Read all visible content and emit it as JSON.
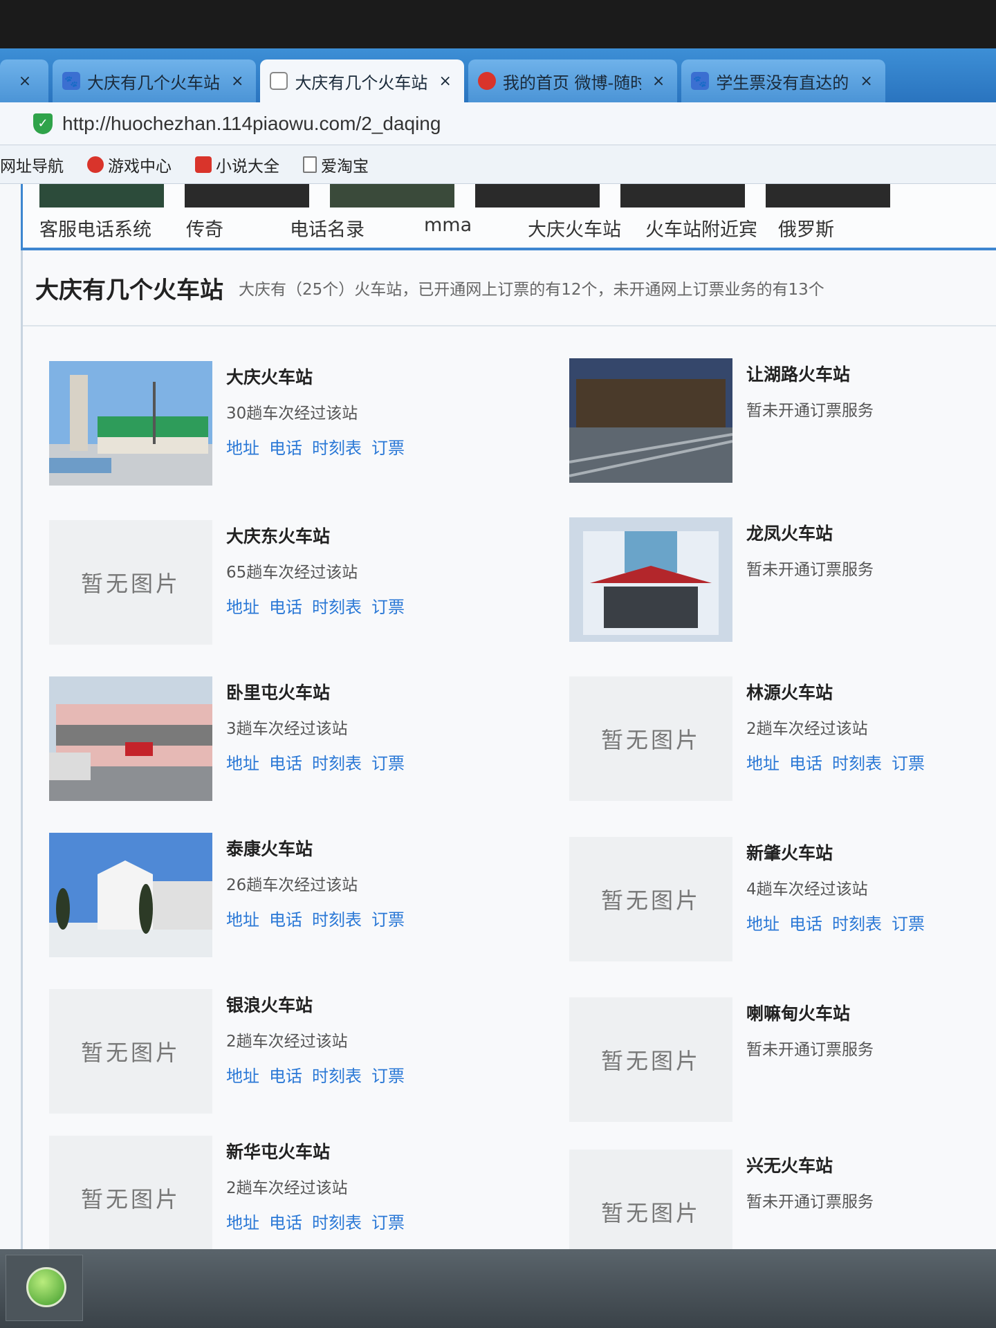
{
  "browser": {
    "tabs": [
      {
        "title": "大庆有几个火车站",
        "active": false
      },
      {
        "title": "大庆有几个火车站",
        "active": true
      },
      {
        "title": "我的首页 微博-随时",
        "active": false
      },
      {
        "title": "学生票没有直达的",
        "active": false
      }
    ],
    "close_glyph": "×",
    "url": "http://huochezhan.114piaowu.com/2_daqing",
    "bookmarks": [
      "网址导航",
      "游戏中心",
      "小说大全",
      "爱淘宝"
    ]
  },
  "topnav": {
    "items": [
      "客服电话系统",
      "传奇",
      "电话名录",
      "mma",
      "大庆火车站",
      "火车站附近宾",
      "俄罗斯"
    ]
  },
  "section": {
    "title": "大庆有几个火车站",
    "subtitle": "大庆有（25个）火车站，已开通网上订票的有12个，未开通网上订票业务的有13个"
  },
  "no_image_text": "暂无图片",
  "link_labels": {
    "address": "地址",
    "phone": "电话",
    "timetable": "时刻表",
    "book": "订票"
  },
  "stations_left": [
    {
      "name": "大庆火车站",
      "detail": "30趟车次经过该站",
      "has_links": true,
      "image": "photo-daqing"
    },
    {
      "name": "大庆东火车站",
      "detail": "65趟车次经过该站",
      "has_links": true,
      "image": null
    },
    {
      "name": "卧里屯火车站",
      "detail": "3趟车次经过该站",
      "has_links": true,
      "image": "photo-wolitun"
    },
    {
      "name": "泰康火车站",
      "detail": "26趟车次经过该站",
      "has_links": true,
      "image": "photo-taikang"
    },
    {
      "name": "银浪火车站",
      "detail": "2趟车次经过该站",
      "has_links": true,
      "image": null
    },
    {
      "name": "新华屯火车站",
      "detail": "2趟车次经过该站",
      "has_links": true,
      "image": null
    }
  ],
  "stations_right": [
    {
      "name": "让湖路火车站",
      "detail": "暂未开通订票服务",
      "has_links": false,
      "image": "photo-ranghulu"
    },
    {
      "name": "龙凤火车站",
      "detail": "暂未开通订票服务",
      "has_links": false,
      "image": "photo-longfeng"
    },
    {
      "name": "林源火车站",
      "detail": "2趟车次经过该站",
      "has_links": true,
      "image": null
    },
    {
      "name": "新肇火车站",
      "detail": "4趟车次经过该站",
      "has_links": true,
      "image": null
    },
    {
      "name": "喇嘛甸火车站",
      "detail": "暂未开通订票服务",
      "has_links": false,
      "image": null
    },
    {
      "name": "兴无火车站",
      "detail": "暂未开通订票服务",
      "has_links": false,
      "image": null
    }
  ]
}
